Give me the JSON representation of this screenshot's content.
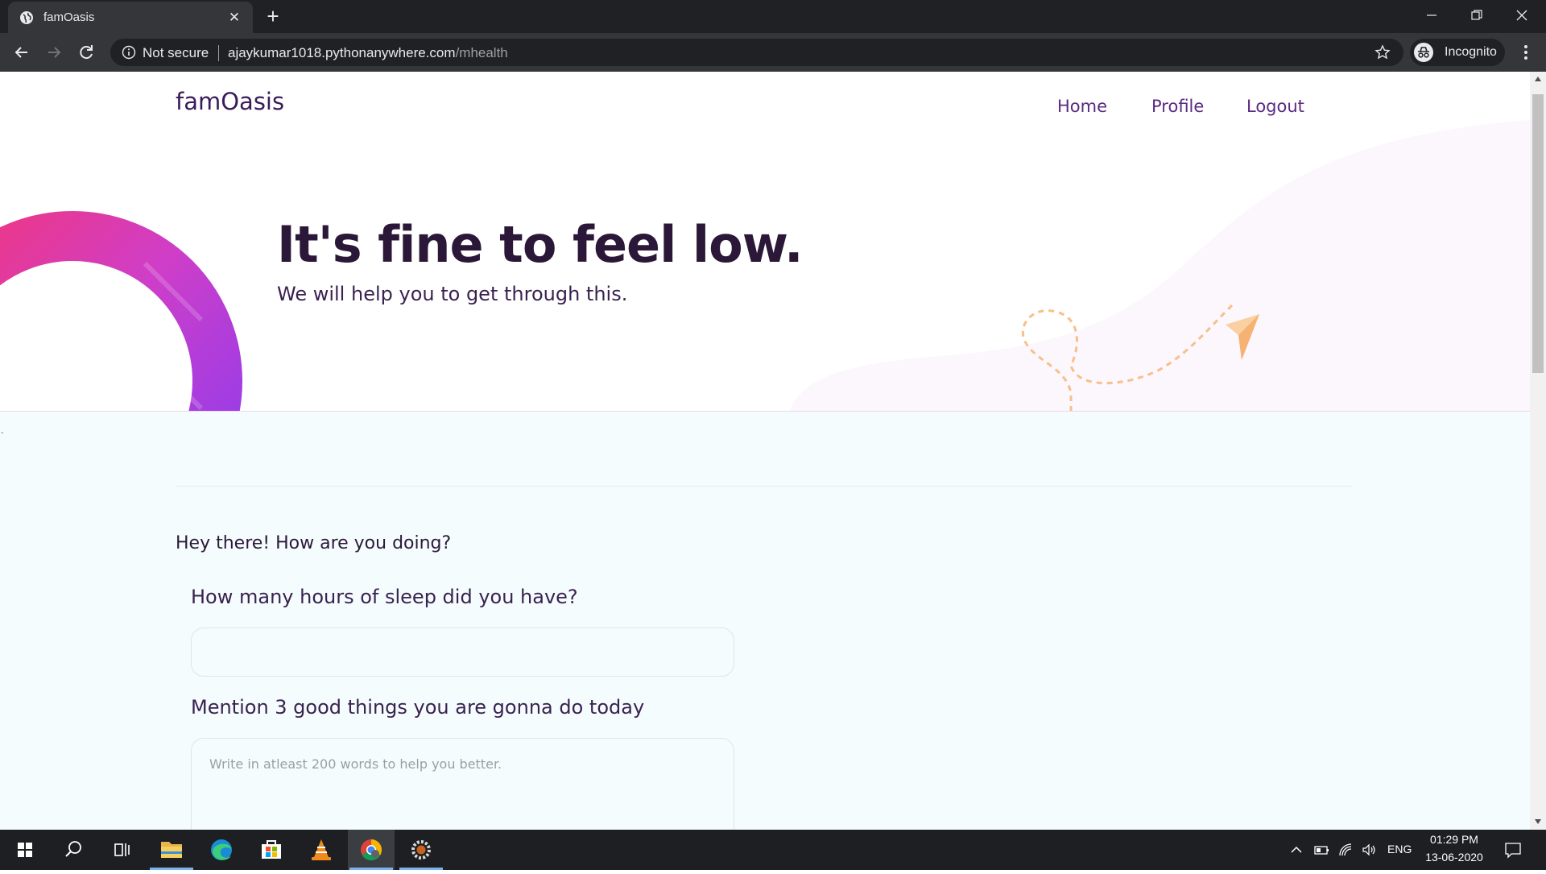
{
  "browser": {
    "tab_title": "famOasis",
    "security_label": "Not secure",
    "url_host": "ajaykumar1018.pythonanywhere.com",
    "url_path": "/mhealth",
    "profile_label": "Incognito"
  },
  "site": {
    "brand": "famOasis",
    "nav": {
      "home": "Home",
      "profile": "Profile",
      "logout": "Logout"
    },
    "headline": "It's fine to feel low.",
    "subheadline": "We will help you to get through this."
  },
  "form": {
    "stray_text": ".",
    "greeting": "Hey there! How are you doing?",
    "sleep_question": "How many hours of sleep did you have?",
    "sleep_value": "",
    "good_things_question": "Mention 3 good things you are gonna do today",
    "good_things_placeholder": "Write in atleast 200 words to help you better."
  },
  "taskbar": {
    "icons": [
      "windows-start-icon",
      "search-icon",
      "task-view-icon",
      "file-explorer-icon",
      "edge-icon",
      "store-icon",
      "vlc-icon",
      "chrome-icon",
      "settings-icon"
    ],
    "time": "01:29 PM",
    "date": "13-06-2020",
    "language": "ENG"
  },
  "colors": {
    "brand_text": "#3a1c5a",
    "nav_link": "#5a2a82",
    "content_bg": "#f4fcfd",
    "ring_pink": "#e0368f",
    "ring_purple": "#8a3cf0",
    "plane": "#f9bf86"
  }
}
